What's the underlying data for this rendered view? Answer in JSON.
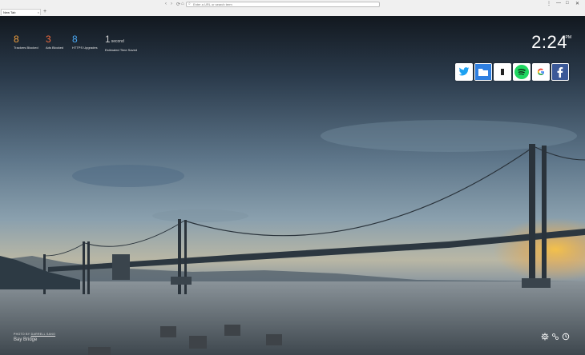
{
  "browser": {
    "tab_title": "New Tab",
    "tab_close": "×",
    "new_tab": "+",
    "nav": {
      "back": "‹",
      "forward": "›",
      "reload": "⟳",
      "home": "⌂"
    },
    "url_placeholder": "Enter a URL or search term",
    "window": {
      "menu": "⋮",
      "minimize": "—",
      "maximize": "□",
      "close": "✕"
    }
  },
  "stats": [
    {
      "value": "8",
      "label": "Trackers Blocked",
      "color": "#f2a03d"
    },
    {
      "value": "3",
      "label": "Ads Blocked",
      "color": "#f26b3d"
    },
    {
      "value": "8",
      "label": "HTTPS Upgrades",
      "color": "#4aa9f4"
    },
    {
      "value": "1",
      "unit": "second",
      "label": "Estimated Time Saved",
      "color": "#cfcfcf"
    }
  ],
  "clock": {
    "time": "2:24",
    "ampm": "PM"
  },
  "tiles": [
    {
      "name": "twitter",
      "color": "#1da1f2"
    },
    {
      "name": "boxed",
      "color": "#2f7fe0"
    },
    {
      "name": "dark-app",
      "color": "#222222"
    },
    {
      "name": "spotify",
      "color": "#1ed760"
    },
    {
      "name": "google",
      "color": "#4285f4"
    },
    {
      "name": "facebook",
      "color": "#3b5998"
    }
  ],
  "photo": {
    "credit_label": "PHOTO BY",
    "photographer": "DARRELL SANO",
    "location": "Bay Bridge"
  },
  "bottom_icons": [
    "settings-icon",
    "bookmarks-icon",
    "history-icon"
  ]
}
